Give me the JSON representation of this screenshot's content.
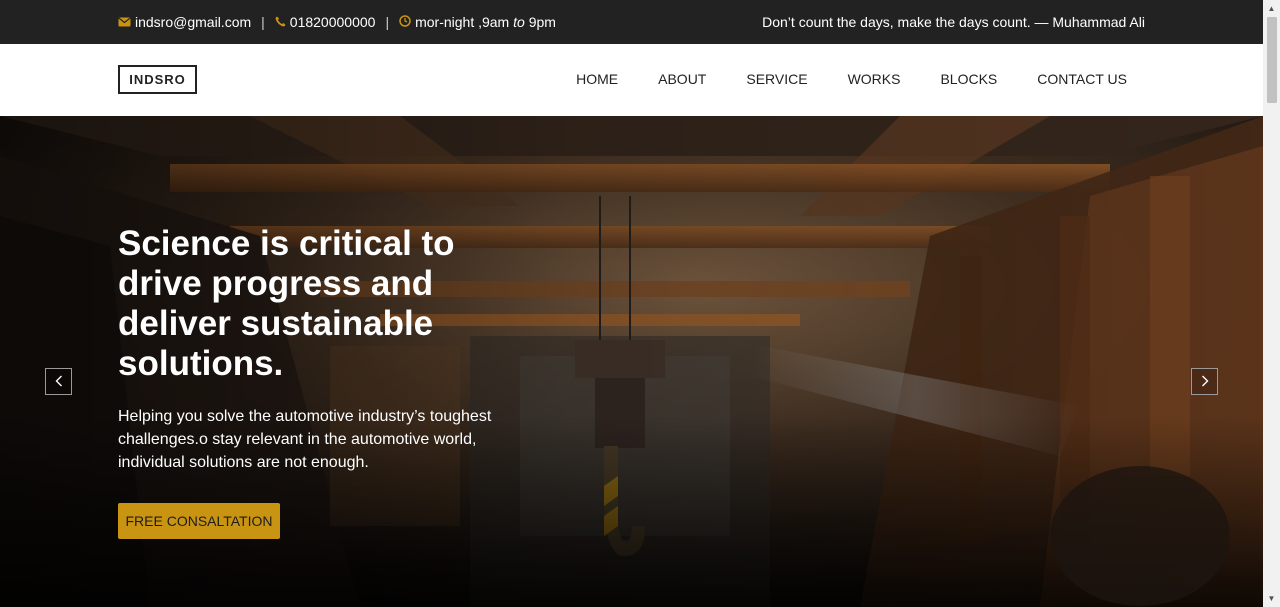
{
  "topbar": {
    "email": "indsro@gmail.com",
    "phone": "01820000000",
    "hours_prefix": "mor-night ,9am ",
    "hours_to": "to",
    "hours_suffix": " 9pm",
    "separator": "|",
    "quote": "Don’t count the days, make the days count. — Muhammad Ali",
    "icons": {
      "email": "envelope-icon",
      "phone": "phone-icon",
      "hours": "clock-icon"
    }
  },
  "nav": {
    "logo": "INDSRO",
    "items": [
      {
        "label": "HOME"
      },
      {
        "label": "ABOUT"
      },
      {
        "label": "SERVICE"
      },
      {
        "label": "WORKS"
      },
      {
        "label": "BLOCKS"
      },
      {
        "label": "CONTACT US"
      }
    ]
  },
  "hero": {
    "title": "Science is critical to drive progress and deliver sustainable solutions.",
    "text": "Helping you solve the automotive industry’s toughest challenges.o stay relevant in the automotive world, individual solutions are not enough.",
    "cta": "FREE CONSALTATION",
    "prev_icon": "chevron-left-icon",
    "next_icon": "chevron-right-icon",
    "background": "industrial-factory-photo"
  },
  "colors": {
    "accent": "#c99412",
    "topbar_bg": "#222222",
    "text_dark": "#222222"
  }
}
